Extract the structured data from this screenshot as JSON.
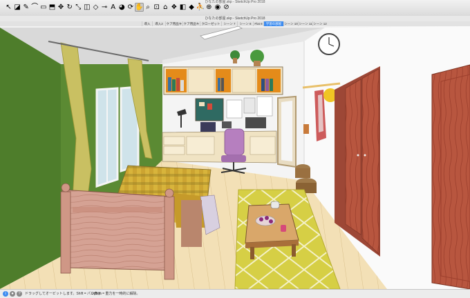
{
  "window": {
    "title": "ひなたの部屋.skp - SketchUp Pro 2018",
    "document_title": "ひなたの部屋.skp - SketchUp Pro 2018"
  },
  "toolbar": {
    "tools": [
      {
        "name": "select-tool",
        "glyph": "↖"
      },
      {
        "name": "eraser-tool",
        "glyph": "◪"
      },
      {
        "name": "pencil-tool",
        "glyph": "✎"
      },
      {
        "name": "arc-tool",
        "glyph": "⌒"
      },
      {
        "name": "rectangle-tool",
        "glyph": "▭"
      },
      {
        "name": "push-pull-tool",
        "glyph": "⬒"
      },
      {
        "name": "move-tool",
        "glyph": "✥"
      },
      {
        "name": "rotate-tool",
        "glyph": "↻"
      },
      {
        "name": "scale-tool",
        "glyph": "⤡"
      },
      {
        "name": "offset-tool",
        "glyph": "◫"
      },
      {
        "name": "follow-me-tool",
        "glyph": "◇"
      },
      {
        "name": "tape-measure-tool",
        "glyph": "⊸"
      },
      {
        "name": "text-tool",
        "glyph": "A"
      },
      {
        "name": "paint-bucket-tool",
        "glyph": "◕"
      },
      {
        "name": "orbit-tool",
        "glyph": "⟳"
      },
      {
        "name": "pan-tool",
        "glyph": "✋"
      },
      {
        "name": "zoom-tool",
        "glyph": "⌕"
      },
      {
        "name": "zoom-extents-tool",
        "glyph": "⊡"
      },
      {
        "name": "warehouse-tool",
        "glyph": "⌂"
      },
      {
        "name": "extension-tool",
        "glyph": "❖"
      },
      {
        "name": "layout-tool",
        "glyph": "◧"
      },
      {
        "name": "ruby-tool",
        "glyph": "◆"
      },
      {
        "name": "walk-tool",
        "glyph": "⛹"
      },
      {
        "name": "position-camera-tool",
        "glyph": "⊕"
      },
      {
        "name": "look-around-tool",
        "glyph": "◉"
      },
      {
        "name": "section-tool",
        "glyph": "⊘"
      }
    ],
    "active_tool": "pan-tool"
  },
  "scene_tabs": [
    {
      "label": "導入"
    },
    {
      "label": "導入2"
    },
    {
      "label": "ケア用品キット"
    },
    {
      "label": "ケア用品キット"
    },
    {
      "label": "クローゼット取り"
    },
    {
      "label": "シーン 7"
    },
    {
      "label": "シーン 8"
    },
    {
      "label": "Flat 8"
    },
    {
      "label": "学習の部屋 2/3",
      "active": true
    },
    {
      "label": "シーン 10"
    },
    {
      "label": "シーン 11"
    },
    {
      "label": "シーン 12"
    }
  ],
  "status": {
    "message": "ドラッグしてオービットします。Shift = パン表示",
    "hint": "Option = 重力を一時的に解除。"
  },
  "colors": {
    "accent_tab": "#3d8cf0",
    "wall_green": "#4f7f2e",
    "floor_wood": "#f1deb1",
    "rug_yellow": "#d9d247",
    "bed_wood": "#d6a08f",
    "door_brown": "#b4533f",
    "chair_purple": "#b87ec0"
  }
}
